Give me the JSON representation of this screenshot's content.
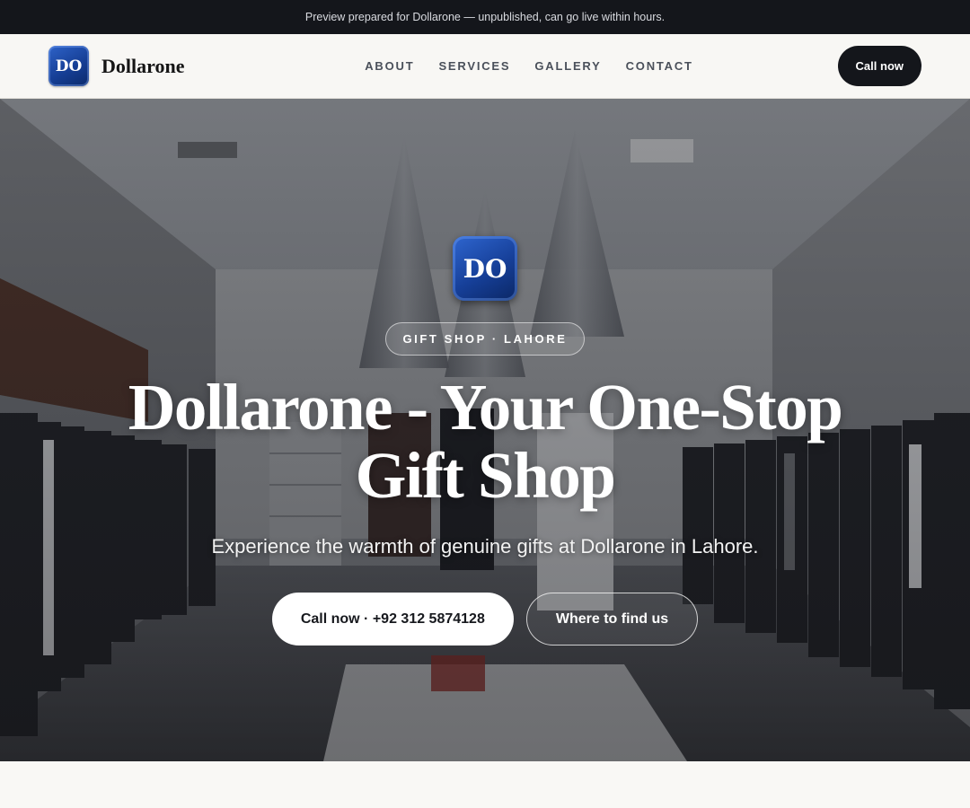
{
  "banner": {
    "text": "Preview prepared for Dollarone — unpublished, can go live within hours."
  },
  "brand": {
    "initials": "DO",
    "name": "Dollarone"
  },
  "nav": {
    "items": [
      {
        "label": "ABOUT"
      },
      {
        "label": "SERVICES"
      },
      {
        "label": "GALLERY"
      },
      {
        "label": "CONTACT"
      }
    ],
    "cta_label": "Call now"
  },
  "hero": {
    "logo_initials": "DO",
    "tag": "GIFT SHOP · LAHORE",
    "title": "Dollarone - Your One-Stop Gift Shop",
    "subtitle": "Experience the warmth of genuine gifts at Dollarone in Lahore.",
    "primary_button": "Call now · +92 312 5874128",
    "secondary_button": "Where to find us",
    "background_image": "store-interior-photo"
  },
  "colors": {
    "dark": "#14161b",
    "logo_blue": "#163f96",
    "page_bg": "#f9f8f5"
  }
}
